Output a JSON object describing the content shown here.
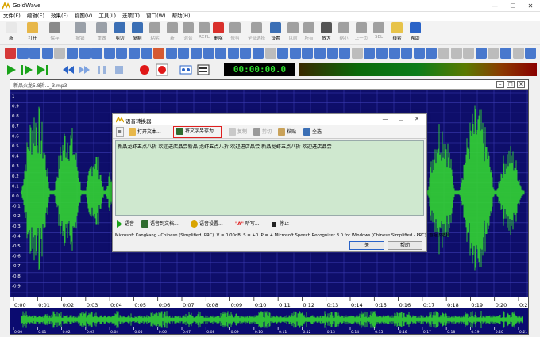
{
  "app": {
    "title": "GoldWave"
  },
  "window_controls": {
    "minimize": "—",
    "maximize": "☐",
    "close": "✕"
  },
  "menus": [
    "文件(F)",
    "编辑(E)",
    "效果(F)",
    "视图(V)",
    "工具(L)",
    "选项(T)",
    "窗口(W)",
    "帮助(H)"
  ],
  "toolbar_main": [
    {
      "label": "新",
      "icon": "new-file-icon",
      "color": "#e8e8e8",
      "enabled": true
    },
    {
      "label": "打开",
      "icon": "open-folder-icon",
      "color": "#e7b74a",
      "enabled": true
    },
    {
      "label": "保存",
      "icon": "save-icon",
      "color": "#8a8a8a",
      "enabled": false
    },
    {
      "label": "撤销",
      "icon": "undo-icon",
      "color": "#9aa0a8",
      "enabled": false
    },
    {
      "label": "重做",
      "icon": "redo-icon",
      "color": "#9aa0a8",
      "enabled": false
    },
    {
      "label": "剪切",
      "icon": "scissors-icon",
      "color": "#3b6fb5",
      "enabled": true
    },
    {
      "label": "复制",
      "icon": "copy-icon",
      "color": "#3b6fb5",
      "enabled": true
    },
    {
      "label": "粘贴",
      "icon": "paste-icon",
      "color": "#a0a0a0",
      "enabled": false
    },
    {
      "label": "新",
      "icon": "paste-new-icon",
      "color": "#a0a0a0",
      "enabled": false
    },
    {
      "label": "混合",
      "icon": "mix-icon",
      "color": "#a0a0a0",
      "enabled": false
    },
    {
      "label": "REPL",
      "icon": "replace-icon",
      "color": "#a0a0a0",
      "enabled": false
    },
    {
      "label": "删除",
      "icon": "delete-icon",
      "color": "#d9302c",
      "enabled": true
    },
    {
      "label": "修剪",
      "icon": "trim-icon",
      "color": "#a0a0a0",
      "enabled": false
    },
    {
      "label": "全部选择",
      "icon": "select-all-icon",
      "color": "#a0a0a0",
      "enabled": false
    },
    {
      "label": "设置",
      "icon": "set-icon",
      "color": "#3b6fb5",
      "enabled": true
    },
    {
      "label": "以前",
      "icon": "previous-icon",
      "color": "#a0a0a0",
      "enabled": false
    },
    {
      "label": "所有",
      "icon": "zoom-all-icon",
      "color": "#a0a0a0",
      "enabled": false
    },
    {
      "label": "放大",
      "icon": "zoom-in-icon",
      "color": "#555",
      "enabled": true
    },
    {
      "label": "缩小",
      "icon": "zoom-out-icon",
      "color": "#a0a0a0",
      "enabled": false
    },
    {
      "label": "上一页",
      "icon": "prev-page-icon",
      "color": "#a0a0a0",
      "enabled": false
    },
    {
      "label": "SEL",
      "icon": "zoom-sel-icon",
      "color": "#a0a0a0",
      "enabled": false
    },
    {
      "label": "线索",
      "icon": "cue-icon",
      "color": "#e7c34a",
      "enabled": true
    },
    {
      "label": "帮助",
      "icon": "help-icon",
      "color": "#2a63c7",
      "enabled": true
    }
  ],
  "timer": {
    "value": "00:00:00.0"
  },
  "wave_window": {
    "filename": "新品火龙5.8折..._3.mp3"
  },
  "y_axis": [
    "1",
    "0.9",
    "0.8",
    "0.7",
    "0.6",
    "0.5",
    "0.4",
    "0.3",
    "0.2",
    "0.1",
    "0.0",
    "-0.1",
    "-0.2",
    "-0.3",
    "-0.4",
    "-0.5",
    "-0.6",
    "-0.7",
    "-0.8",
    "-0.9"
  ],
  "ruler_ticks": [
    "0:00",
    "0:01",
    "0:02",
    "0:03",
    "0:04",
    "0:05",
    "0:06",
    "0:07",
    "0:08",
    "0:09",
    "0:10",
    "0:11",
    "0:12",
    "0:13",
    "0:14",
    "0:15",
    "0:16",
    "0:17",
    "0:18",
    "0:19",
    "0:20",
    "0:21"
  ],
  "overview_ticks": [
    "0:00",
    "0:01",
    "0:02",
    "0:03",
    "0:04",
    "0:05",
    "0:06",
    "0:07",
    "0:08",
    "0:09",
    "0:10",
    "0:11",
    "0:12",
    "0:13",
    "0:14",
    "0:15",
    "0:16",
    "0:17",
    "0:18",
    "0:19",
    "0:20",
    "0:21"
  ],
  "colors": {
    "wave_bg": "#0e0e6a",
    "wave": "#33d433",
    "grid": "#3a3ab0",
    "highlight": "#e02020",
    "text_area": "#cfe8cf"
  },
  "dialog": {
    "title": "语音转换器",
    "toolbar": {
      "menu": "≡",
      "open_text": "打开文本...",
      "save_text_as": "将文字另存为...",
      "copy": "复制",
      "cut": "剪切",
      "paste": "粘贴",
      "select_all": "全选"
    },
    "text": "新品龙虾五点八折 欢迎进店品尝新品 龙虾五点八折 欢迎进店品尝 新品龙虾五点八折 欢迎进店品尝",
    "bottom_toolbar": {
      "speak": "语音",
      "speak_doc": "语音到文档...",
      "voice_settings": "语音设置...",
      "dictate": "听写...",
      "stop": "停止"
    },
    "status": "Microsoft Kangkang - Chinese (Simplified, PRC).  V = 0.00dB.  S = +0.  P = +  Microsoft Speech Recognizer 8.0 for Windows (Chinese Simplified - PRC). 首拒识选择",
    "ok": "关",
    "help": "帮助"
  }
}
